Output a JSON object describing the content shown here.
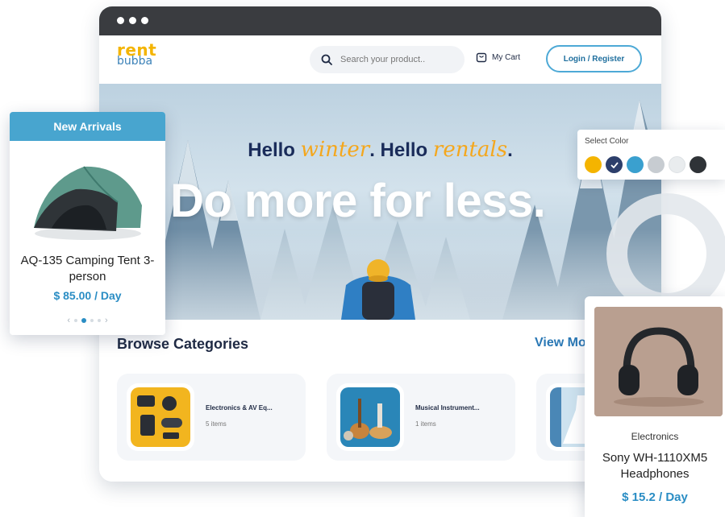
{
  "brand": {
    "logo_top": "rent",
    "logo_bottom": "bubba"
  },
  "header": {
    "search_placeholder": "Search your product..",
    "cart_label": "My Cart",
    "login_label": "Login / Register"
  },
  "hero": {
    "hello1": "Hello ",
    "word1": "winter",
    "hello2": ". Hello ",
    "word2": "rentals",
    "dot": ".",
    "tagline": "Do more for less."
  },
  "categories": {
    "title": "Browse Categories",
    "view_more": "View More",
    "items": [
      {
        "name": "Electronics & AV Eq...",
        "count": "5 items"
      },
      {
        "name": "Musical Instrument...",
        "count": "1 items"
      },
      {
        "name": "",
        "count": ""
      }
    ]
  },
  "new_arrivals": {
    "header": "New Arrivals",
    "product_name": "AQ-135 Camping Tent 3-person",
    "price": "$ 85.00 / Day",
    "pager": {
      "prev": "‹",
      "next": "›",
      "active_index": 1,
      "total": 4
    }
  },
  "color_picker": {
    "label": "Select Color",
    "swatches": [
      "#f4b400",
      "#2d3f6b",
      "#3aa0cf",
      "#c7ccd1",
      "#e9ecee",
      "#2f3337"
    ],
    "selected_index": 1
  },
  "featured_product": {
    "category": "Electronics",
    "name": "Sony WH-1110XM5 Headphones",
    "price": "$ 15.2 / Day"
  },
  "colors": {
    "accent": "#2a8dc4",
    "brand_yellow": "#f4b400",
    "header_blue": "#48a5cf"
  }
}
